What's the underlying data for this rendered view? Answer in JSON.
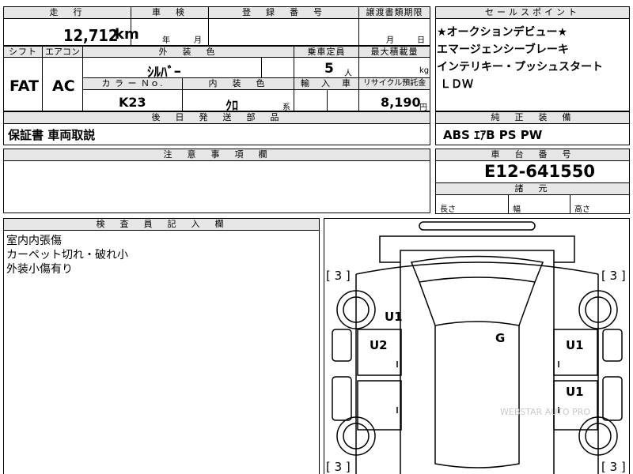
{
  "top": {
    "mileage_header": "走　行",
    "mileage_value": "12,712",
    "mileage_unit": "km",
    "inspection_header": "車　検",
    "inspection_year_unit": "年",
    "inspection_month_unit": "月",
    "registration_header": "登　録　番　号",
    "transfer_header": "譲渡書類期限",
    "transfer_month_unit": "月",
    "transfer_day_unit": "日"
  },
  "spec": {
    "shift_header": "シフト",
    "aircon_header": "エアコン",
    "exterior_color_header": "外　装　色",
    "capacity_header": "乗車定員",
    "max_load_header": "最大積載量",
    "shift_value": "FAT",
    "aircon_value": "AC",
    "exterior_color_value": "ｼﾙﾊﾞｰ",
    "capacity_value": "5",
    "capacity_unit": "人",
    "max_load_unit": "kg",
    "color_no_header": "カ ラ ー Ｎｏ.",
    "interior_color_header": "内　装　色",
    "import_header": "輸　入　車",
    "recycle_header": "リサイクル預託金",
    "color_no_value": "K23",
    "interior_color_value": "ｸﾛ",
    "interior_color_suffix": "系",
    "recycle_value": "8,190",
    "recycle_unit": "円"
  },
  "later_parts": {
    "header": "後　日　発　送　部　品",
    "value": "保証書 車両取説"
  },
  "notes": {
    "header": "注　意　事　項　欄"
  },
  "sales_point": {
    "header": "セールスポイント",
    "lines": [
      "★オークションデビュー★",
      "エマージェンシーブレーキ",
      "インテリキー・プッシュスタート",
      "ＬＤＷ"
    ]
  },
  "equipment": {
    "header": "純　正　装　備",
    "value": "ABS ｴｱB PS PW"
  },
  "chassis": {
    "header": "車　台　番　号",
    "value": "E12-641550"
  },
  "dimensions": {
    "header": "諸　元",
    "length_label": "長さ",
    "width_label": "幅",
    "height_label": "高さ"
  },
  "inspector": {
    "header": "検　査　員　記　入　欄",
    "lines": [
      "室内内張傷",
      "カーペット切れ・破れ小",
      "外装小傷有り"
    ]
  },
  "diagram": {
    "tire_marks": [
      "[ 3 ]",
      "[ 3 ]",
      "[ 3 ]",
      "[ 3 ]"
    ],
    "damage_marks": [
      "U1",
      "U2",
      "U1",
      "U1",
      "G"
    ],
    "watermark": "WEBSTAR AUTO PRO"
  }
}
